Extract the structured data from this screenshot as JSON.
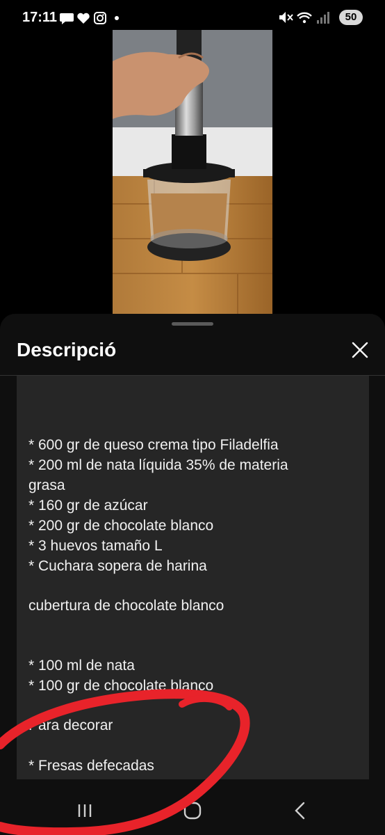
{
  "status_bar": {
    "time": "17:11",
    "battery": "50",
    "left_icons": [
      "chat-bubble-icon",
      "heart-icon",
      "instagram-icon",
      "dot-icon"
    ],
    "right_icons": [
      "mute-icon",
      "wifi-icon",
      "signal-icon",
      "battery-icon"
    ]
  },
  "video": {
    "description": "Video thumbnail"
  },
  "sheet": {
    "title": "Descripció",
    "close_icon": "close-icon"
  },
  "description": {
    "lines": [
      "* 600 gr de queso crema tipo Filadelfia",
      "* 200 ml de nata líquida 35% de materia",
      "grasa",
      "* 160 gr de azúcar",
      "* 200 gr de chocolate blanco",
      "* 3 huevos tamaño L",
      "* Cuchara sopera de harina",
      "cubertura de chocolate blanco",
      "*  100 ml de nata",
      "* 100 gr de chocolate blanco",
      "Para decorar",
      "* Fresas defecadas"
    ]
  },
  "navbar": {
    "recents_icon": "recents-icon",
    "home_icon": "home-icon",
    "back_icon": "back-icon"
  },
  "annotation": {
    "color": "#e8232a"
  }
}
